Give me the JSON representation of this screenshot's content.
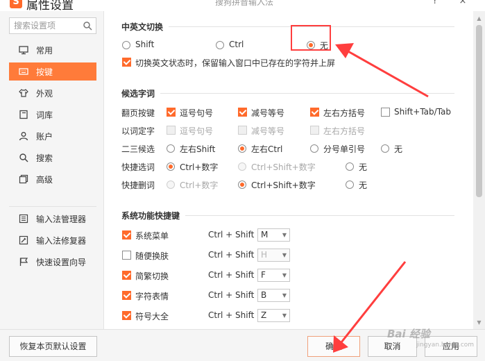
{
  "window": {
    "app_title": "属性设置",
    "caption": "搜狗拼音输入法",
    "help_label": "?",
    "close_label": "×",
    "logo_letter": "S"
  },
  "sidebar": {
    "search_placeholder": "搜索设置项",
    "items": [
      {
        "label": "常用",
        "icon": "monitor-icon"
      },
      {
        "label": "按键",
        "icon": "keyboard-icon",
        "active": true
      },
      {
        "label": "外观",
        "icon": "shirt-icon"
      },
      {
        "label": "词库",
        "icon": "book-icon"
      },
      {
        "label": "账户",
        "icon": "user-icon"
      },
      {
        "label": "搜索",
        "icon": "magnifier-icon"
      },
      {
        "label": "高级",
        "icon": "layers-icon"
      }
    ],
    "tools": [
      {
        "label": "输入法管理器",
        "icon": "manager-icon"
      },
      {
        "label": "输入法修复器",
        "icon": "repair-icon"
      },
      {
        "label": "快速设置向导",
        "icon": "flag-icon"
      }
    ]
  },
  "switch_section": {
    "title": "中英文切换",
    "options": [
      "Shift",
      "Ctrl",
      "无"
    ],
    "selected": "无",
    "keep_text_label": "切换英文状态时，保留输入窗口中已存在的字符并上屏",
    "keep_text_checked": true
  },
  "candidate_section": {
    "title": "候选字词",
    "page_keys": {
      "label": "翻页按键",
      "options": [
        {
          "label": "逗号句号",
          "checked": true
        },
        {
          "label": "减号等号",
          "checked": true
        },
        {
          "label": "左右方括号",
          "checked": true
        },
        {
          "label": "Shift+Tab/Tab",
          "checked": false
        }
      ]
    },
    "word_select": {
      "label": "以词定字",
      "options": [
        {
          "label": "逗号句号",
          "checked": false
        },
        {
          "label": "减号等号",
          "checked": false
        },
        {
          "label": "左右方括号",
          "checked": false
        }
      ]
    },
    "second_third": {
      "label": "二三候选",
      "options": [
        "左右Shift",
        "左右Ctrl",
        "分号单引号",
        "无"
      ],
      "selected": "左右Ctrl"
    },
    "quick_select": {
      "label": "快捷选词",
      "options": [
        "Ctrl+数字",
        "Ctrl+Shift+数字",
        "无"
      ],
      "selected": "Ctrl+数字"
    },
    "quick_delete": {
      "label": "快捷删词",
      "options": [
        "Ctrl+数字",
        "Ctrl+Shift+数字",
        "无"
      ],
      "selected": "Ctrl+Shift+数字"
    }
  },
  "shortcut_section": {
    "title": "系统功能快捷键",
    "prefix": "Ctrl + Shift +",
    "items": [
      {
        "label": "系统菜单",
        "checked": true,
        "key": "M"
      },
      {
        "label": "随便换肤",
        "checked": false,
        "key": "H"
      },
      {
        "label": "简繁切换",
        "checked": true,
        "key": "F"
      },
      {
        "label": "字符表情",
        "checked": true,
        "key": "B"
      },
      {
        "label": "符号大全",
        "checked": true,
        "key": "Z"
      }
    ]
  },
  "footer": {
    "restore_label": "恢复本页默认设置",
    "ok_label": "确定",
    "cancel_label": "取消",
    "apply_label": "应用"
  },
  "watermark": {
    "brand": "Bai  经验",
    "site": "jingyan.baidu.com"
  },
  "colors": {
    "accent": "#ff7b3a",
    "annotation": "#ff3e3e"
  }
}
